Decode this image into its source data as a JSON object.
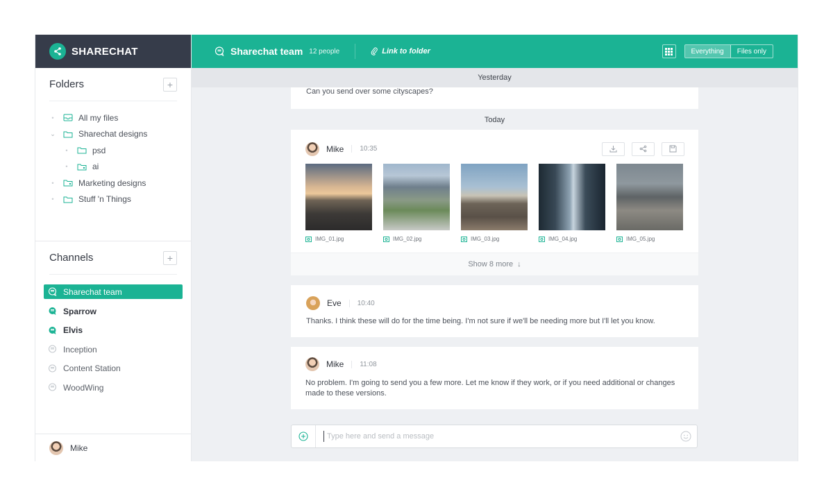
{
  "brand": {
    "name": "SHARECHAT"
  },
  "folders": {
    "title": "Folders",
    "add_label": "+",
    "items": [
      {
        "label": "All my files"
      },
      {
        "label": "Sharechat designs"
      },
      {
        "label": "psd"
      },
      {
        "label": "ai"
      },
      {
        "label": "Marketing designs"
      },
      {
        "label": "Stuff 'n Things"
      }
    ]
  },
  "channels": {
    "title": "Channels",
    "add_label": "+",
    "items": [
      {
        "label": "Sharechat team",
        "state": "active"
      },
      {
        "label": "Sparrow",
        "state": "unread"
      },
      {
        "label": "Elvis",
        "state": "unread"
      },
      {
        "label": "Inception",
        "state": "read"
      },
      {
        "label": "Content Station",
        "state": "read"
      },
      {
        "label": "WoodWing",
        "state": "read"
      }
    ]
  },
  "current_user": {
    "name": "Mike"
  },
  "header": {
    "channel_name": "Sharechat team",
    "people_count": "12 people",
    "link_folder": "Link to folder",
    "filter_options": [
      "Everything",
      "Files only"
    ],
    "filter_selected": "Everything"
  },
  "feed": {
    "yesterday_label": "Yesterday",
    "previous_message": "Can you send over some cityscapes?",
    "today_label": "Today",
    "files_message": {
      "author": "Mike",
      "time": "10:35",
      "files": [
        {
          "name": "IMG_01.jpg"
        },
        {
          "name": "IMG_02.jpg"
        },
        {
          "name": "IMG_03.jpg"
        },
        {
          "name": "IMG_04.jpg"
        },
        {
          "name": "IMG_05.jpg"
        }
      ],
      "show_more": "Show 8 more"
    },
    "messages": [
      {
        "author": "Eve",
        "time": "10:40",
        "text": "Thanks. I think these will do for the time being. I'm not sure if we'll be needing more but I'll let you know."
      },
      {
        "author": "Mike",
        "time": "11:08",
        "text": "No problem. I'm going to send you a few more. Let me know if they work, or if you need additional or changes made to these versions."
      }
    ]
  },
  "composer": {
    "placeholder": "Type here and send a message"
  },
  "colors": {
    "accent": "#1bb394",
    "brand_bar": "#363c4a",
    "canvas": "#eef0f3"
  }
}
